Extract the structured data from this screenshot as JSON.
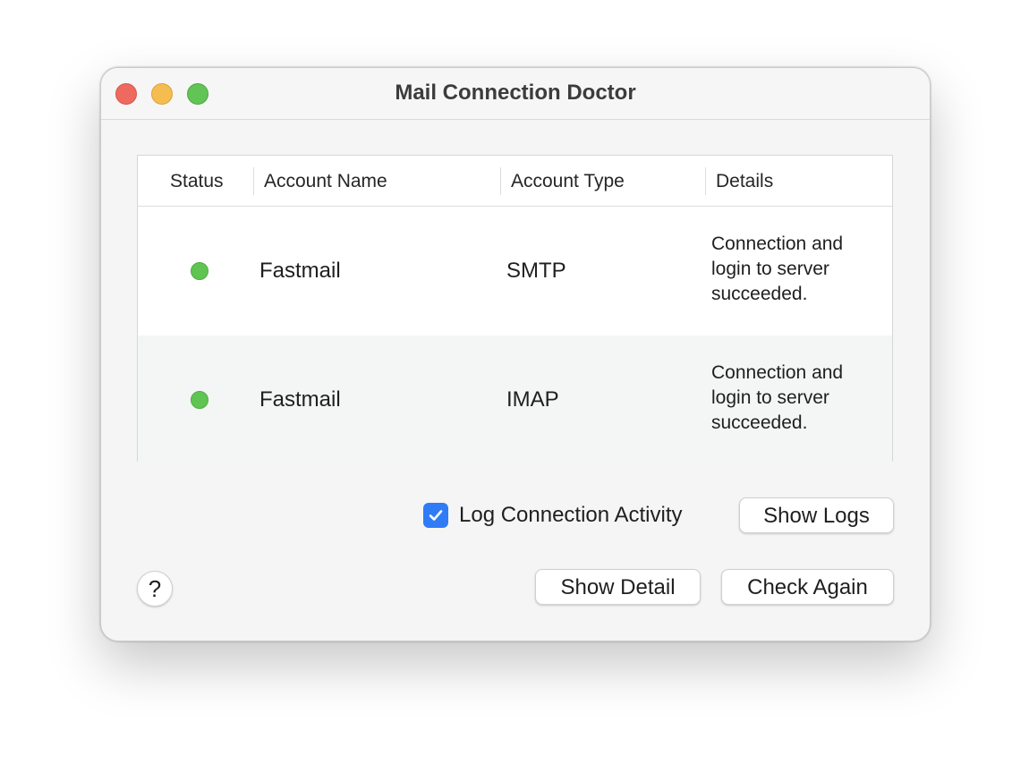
{
  "window": {
    "title": "Mail Connection Doctor"
  },
  "table": {
    "columns": [
      "Status",
      "Account Name",
      "Account Type",
      "Details"
    ],
    "rows": [
      {
        "status": "connected",
        "status_color": "#5fc452",
        "account_name": "Fastmail",
        "account_type": "SMTP",
        "details": "Connection and login to server succeeded."
      },
      {
        "status": "connected",
        "status_color": "#5fc452",
        "account_name": "Fastmail",
        "account_type": "IMAP",
        "details": "Connection and login to server succeeded."
      }
    ]
  },
  "options": {
    "log_activity_label": "Log Connection Activity",
    "log_activity_checked": true
  },
  "buttons": {
    "show_logs": "Show Logs",
    "show_detail": "Show Detail",
    "check_again": "Check Again",
    "help": "?"
  },
  "colors": {
    "accent": "#2f7cf6",
    "close": "#ee6a5f",
    "minimize": "#f5bd4f",
    "maximize": "#61c454"
  }
}
